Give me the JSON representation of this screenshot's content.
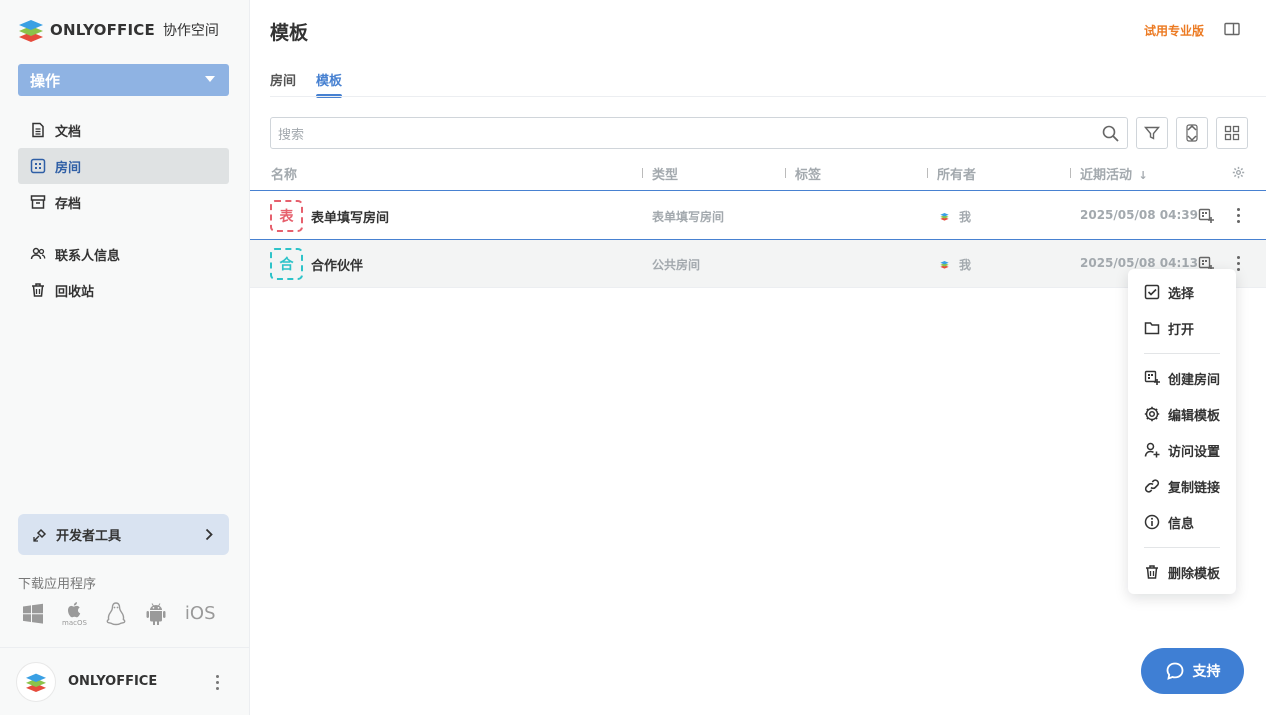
{
  "app": {
    "logo_text": "ONLYOFFICE",
    "logo_sub": "协作空间"
  },
  "sidebar": {
    "action_label": "操作",
    "items": [
      {
        "label": "文档",
        "icon": "document-icon"
      },
      {
        "label": "房间",
        "icon": "rooms-icon",
        "active": true
      },
      {
        "label": "存档",
        "icon": "archive-icon"
      },
      {
        "label": "联系人信息",
        "icon": "contacts-icon"
      },
      {
        "label": "回收站",
        "icon": "trash-icon"
      }
    ],
    "dev_tools_label": "开发者工具",
    "download_title": "下载应用程序",
    "download_platforms": [
      "windows",
      "macOS",
      "linux",
      "android",
      "iOS"
    ],
    "macos_label": "macOS",
    "ios_label": "iOS",
    "profile_name": "ONLYOFFICE"
  },
  "header": {
    "title": "模板",
    "upgrade_label": "试用专业版"
  },
  "tabs": [
    {
      "label": "房间"
    },
    {
      "label": "模板",
      "active": true
    }
  ],
  "search": {
    "placeholder": "搜索"
  },
  "table": {
    "columns": [
      "名称",
      "类型",
      "标签",
      "所有者",
      "近期活动"
    ],
    "sort_indicator": "↓",
    "rows": [
      {
        "icon_char": "表",
        "name": "表单填写房间",
        "type": "表单填写房间",
        "owner": "我",
        "activity": "2025/05/08 04:39",
        "color": "#e6606d"
      },
      {
        "icon_char": "合",
        "name": "合作伙伴",
        "type": "公共房间",
        "owner": "我",
        "activity": "2025/05/08 04:13",
        "color": "#2ec3c9"
      }
    ]
  },
  "context_menu": {
    "items": [
      "选择",
      "打开",
      "创建房间",
      "编辑模板",
      "访问设置",
      "复制链接",
      "信息",
      "删除模板"
    ]
  },
  "support_label": "支持",
  "colors": {
    "accent": "#4781d1",
    "upgrade": "#ec7a22",
    "action_button": "#8fb3e3",
    "support": "#3f7fd4"
  }
}
